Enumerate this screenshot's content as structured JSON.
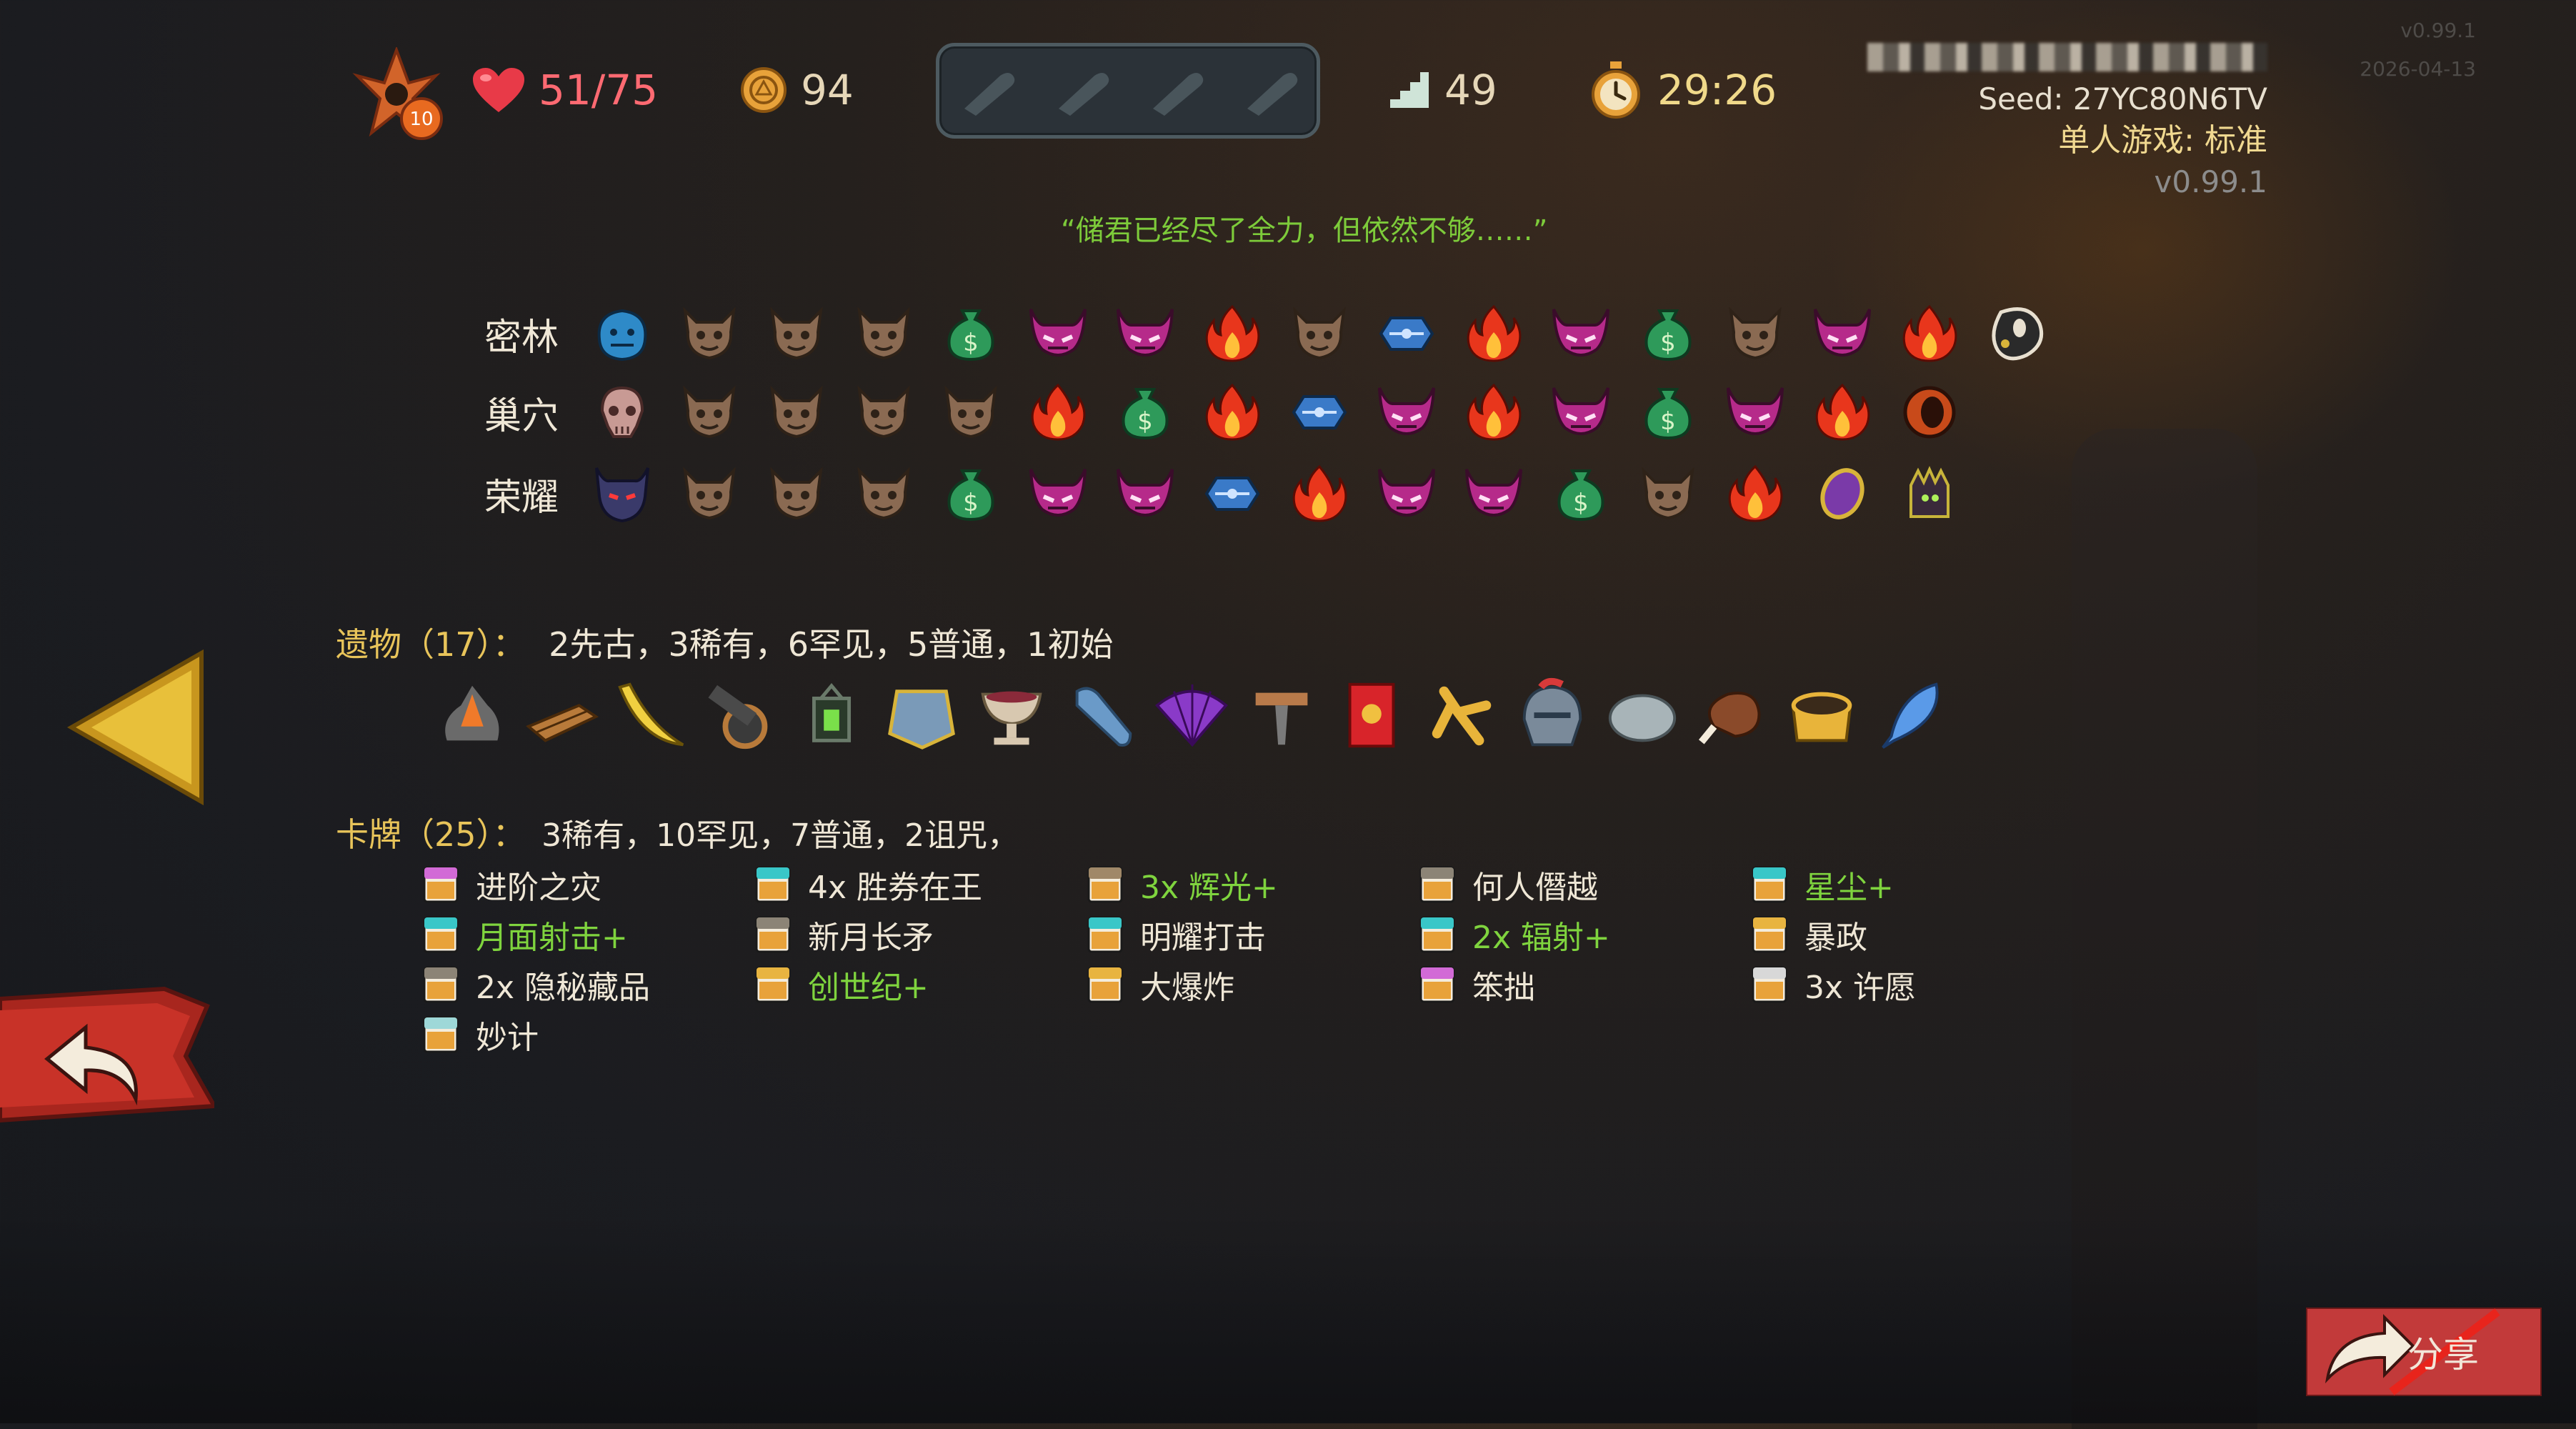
{
  "top_bar": {
    "ascension_level": "10",
    "hp": "51/75",
    "gold": "94",
    "floor": "49",
    "timer": "29:26",
    "potion_slots": 4
  },
  "run_info": {
    "seed": "Seed: 27YC80N6TV",
    "mode": "单人游戏: 标准",
    "version": "v0.99.1",
    "corner_version": "v0.99.1",
    "corner_date": "2026-04-13"
  },
  "quote": "“储君已经尽了全力，但依然不够……”",
  "acts": [
    {
      "name": "密林",
      "boss": "blue-slime-boss-icon",
      "nodes": [
        "monster",
        "monster",
        "monster",
        "merchant",
        "elite",
        "elite",
        "campfire",
        "monster",
        "treasure",
        "campfire",
        "elite",
        "merchant",
        "monster",
        "elite",
        "campfire",
        "boss-ghost"
      ]
    },
    {
      "name": "巢穴",
      "boss": "skull-boss-icon",
      "nodes": [
        "monster",
        "monster",
        "monster",
        "monster",
        "campfire",
        "merchant",
        "campfire",
        "treasure",
        "elite",
        "campfire",
        "elite",
        "merchant",
        "elite",
        "campfire",
        "boss-ring"
      ]
    },
    {
      "name": "荣耀",
      "boss": "demon-boss-icon",
      "nodes": [
        "monster",
        "monster",
        "monster",
        "merchant",
        "elite",
        "elite",
        "treasure",
        "campfire",
        "elite",
        "elite",
        "merchant",
        "monster",
        "campfire",
        "amulet",
        "boss-knight"
      ]
    }
  ],
  "relics": {
    "title": "遗物（17）：",
    "summary": "2先古，3稀有，6罕见，5普通，1初始",
    "items": [
      "ember-rock",
      "wood-planks",
      "banana-boomerang",
      "cannon",
      "lantern",
      "cape",
      "chalice",
      "sleeping-bag",
      "folding-fan",
      "anvil-hammer",
      "red-envelope",
      "golden-claw",
      "knight-helmet",
      "smooth-stone",
      "meat-bone",
      "gold-crown",
      "blue-feather"
    ]
  },
  "cards": {
    "title": "卡牌（25）：",
    "summary": "3稀有，10罕见，7普通，2诅咒，",
    "items": [
      {
        "label": "进阶之灾",
        "color": "#d26ad6",
        "upgraded": false
      },
      {
        "label": "4x 胜券在王",
        "color": "#39c7c8",
        "upgraded": false
      },
      {
        "label": "3x 辉光+",
        "color": "#a08868",
        "upgraded": true
      },
      {
        "label": "何人僭越",
        "color": "#8c8476",
        "upgraded": false
      },
      {
        "label": "星尘+",
        "color": "#39c7c8",
        "upgraded": true
      },
      {
        "label": "月面射击+",
        "color": "#39c7c8",
        "upgraded": true
      },
      {
        "label": "新月长矛",
        "color": "#8c8476",
        "upgraded": false
      },
      {
        "label": "明耀打击",
        "color": "#39c7c8",
        "upgraded": false
      },
      {
        "label": "2x 辐射+",
        "color": "#39c7c8",
        "upgraded": true
      },
      {
        "label": "暴政",
        "color": "#e8b440",
        "upgraded": false
      },
      {
        "label": "2x 隐秘藏品",
        "color": "#8c8476",
        "upgraded": false
      },
      {
        "label": "创世纪+",
        "color": "#e8b440",
        "upgraded": true
      },
      {
        "label": "大爆炸",
        "color": "#e8b440",
        "upgraded": false
      },
      {
        "label": "笨拙",
        "color": "#d26ad6",
        "upgraded": false
      },
      {
        "label": "3x 许愿",
        "color": "#d8d8d8",
        "upgraded": false
      },
      {
        "label": "妙计",
        "color": "#9ed8d8",
        "upgraded": false
      }
    ]
  },
  "buttons": {
    "share_label": "分享"
  },
  "colors": {
    "accent_gold": "#e8c45a",
    "upgraded_green": "#7fd43e",
    "hp_red": "#ff6a72"
  }
}
